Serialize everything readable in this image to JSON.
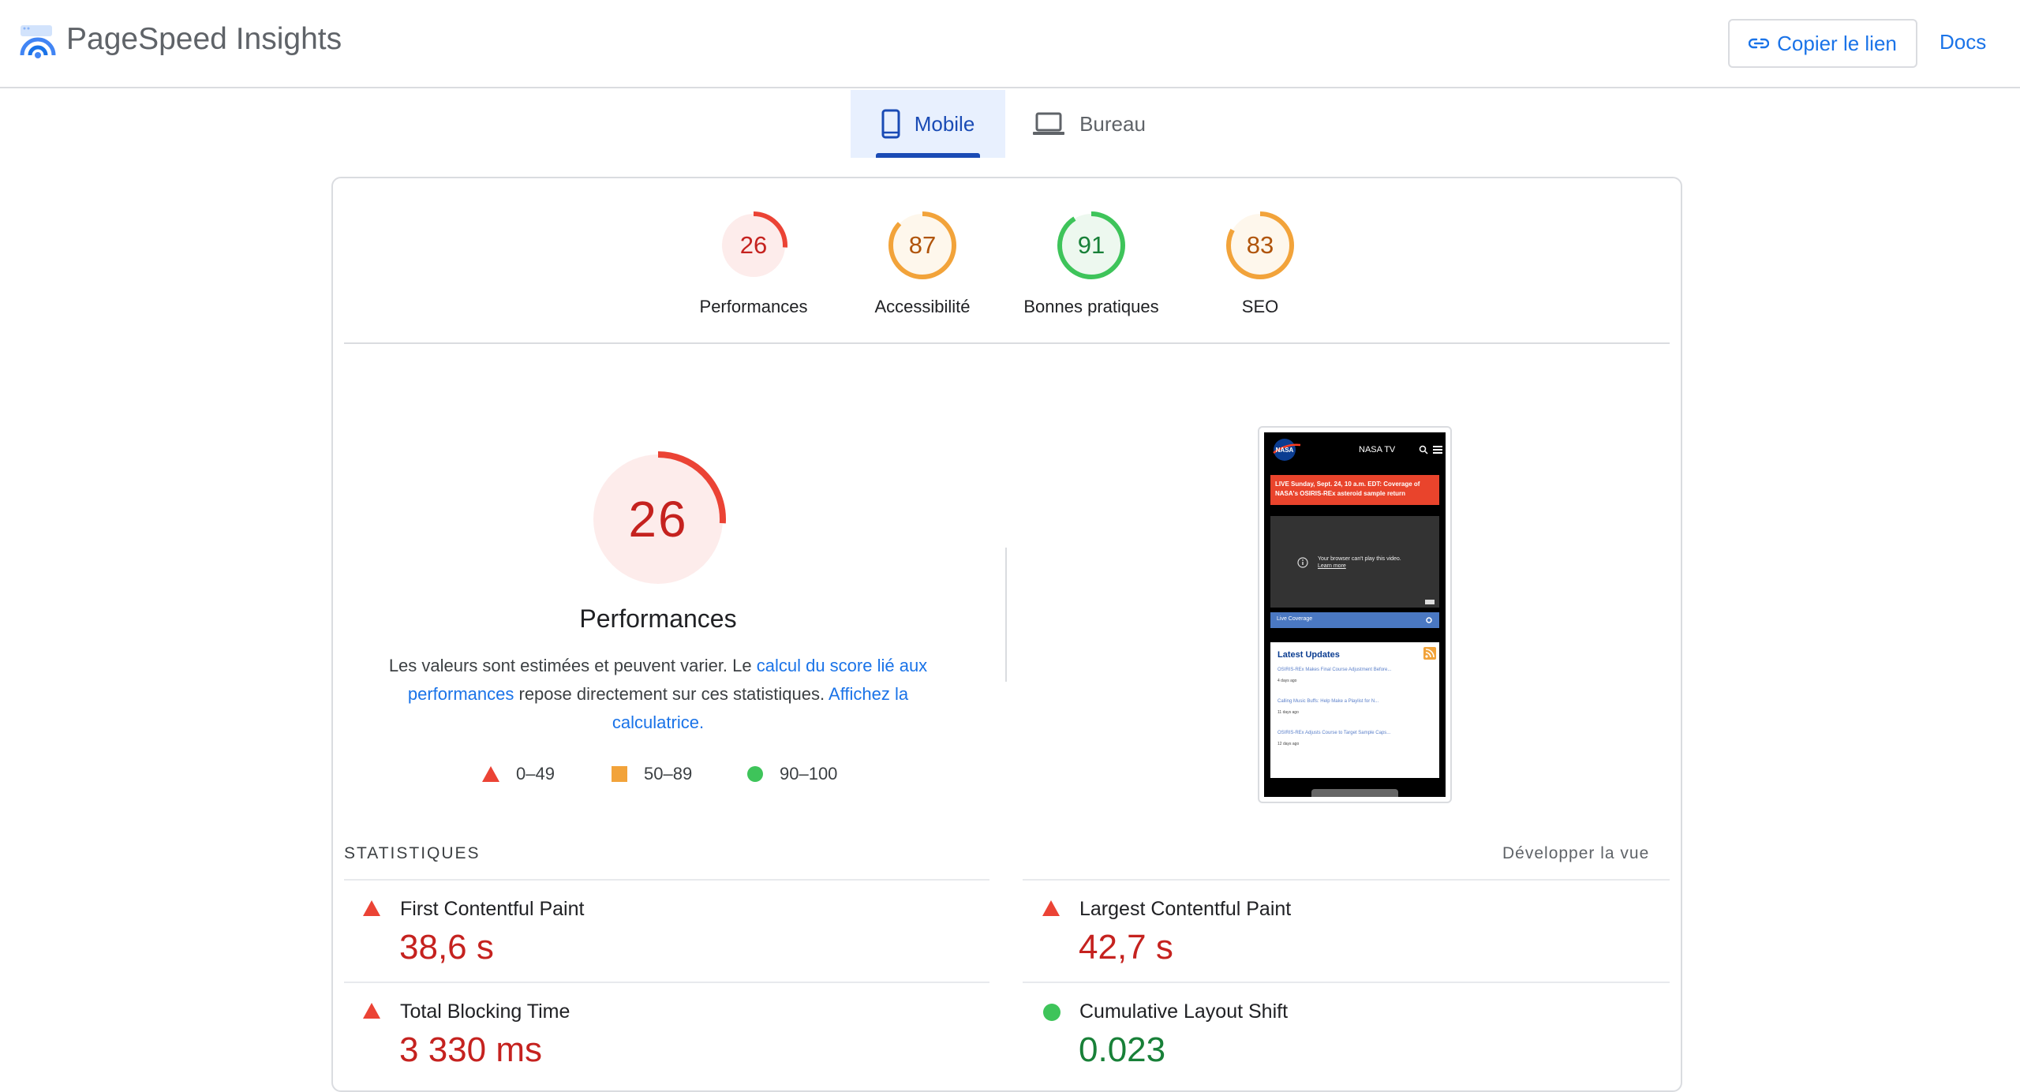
{
  "header": {
    "title": "PageSpeed Insights",
    "copy_link_label": "Copier le lien",
    "docs_label": "Docs"
  },
  "tabs": [
    {
      "label": "Mobile",
      "selected": true
    },
    {
      "label": "Bureau",
      "selected": false
    }
  ],
  "categories": [
    {
      "score": "26",
      "label": "Performances",
      "color": "#c5221f",
      "fill": 0.26
    },
    {
      "score": "87",
      "label": "Accessibilité",
      "color": "#b0540a",
      "fill": 0.87
    },
    {
      "score": "91",
      "label": "Bonnes pratiques",
      "color": "#188038",
      "fill": 0.91
    },
    {
      "score": "83",
      "label": "SEO",
      "color": "#b0540a",
      "fill": 0.83
    }
  ],
  "performance": {
    "score": "26",
    "fill": 0.26,
    "title": "Performances",
    "desc_1": "Les valeurs sont estimées et peuvent varier. Le ",
    "desc_link_1": "calcul du score lié aux performances",
    "desc_2": " repose directement sur ces statistiques. ",
    "desc_link_2": "Affichez la calculatrice.",
    "legend": [
      "0–49",
      "50–89",
      "90–100"
    ]
  },
  "screenshot": {
    "nav_text": "NASA TV",
    "banner": "LIVE Sunday, Sept. 24, 10 a.m. EDT: Coverage of NASA's OSIRIS-REx asteroid sample return",
    "video_msg": "Your browser can't play this video.",
    "video_link": "Learn more",
    "live_bar": "Live Coverage",
    "updates_title": "Latest Updates",
    "updates": [
      {
        "title": "OSIRIS-REx Makes Final Course Adjustment Before...",
        "age": "4 days ago"
      },
      {
        "title": "Calling Music Buffs: Help Make a Playlist for N...",
        "age": "11 days ago"
      },
      {
        "title": "OSIRIS-REx Adjusts Course to Target Sample Caps...",
        "age": "12 days ago"
      }
    ]
  },
  "stats": {
    "title": "STATISTIQUES",
    "expand": "Développer la vue",
    "metrics": [
      {
        "label": "First Contentful Paint",
        "value": "38,6 s",
        "status": "poor"
      },
      {
        "label": "Largest Contentful Paint",
        "value": "42,7 s",
        "status": "poor"
      },
      {
        "label": "Total Blocking Time",
        "value": "3 330 ms",
        "status": "poor"
      },
      {
        "label": "Cumulative Layout Shift",
        "value": "0.023",
        "status": "good"
      }
    ]
  },
  "colors": {
    "accent": "#1a73e8",
    "poor": "#eb4335",
    "average": "#f2a33a",
    "good": "#3ec45a"
  }
}
